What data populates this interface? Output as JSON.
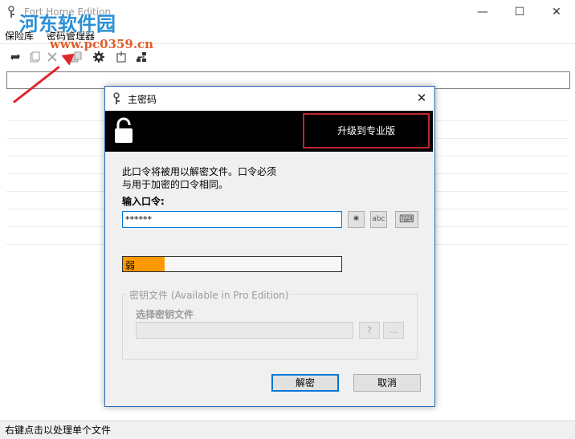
{
  "main_window": {
    "title": "Fort Home Edition",
    "controls": {
      "minimize": "—",
      "maximize": "☐",
      "close": "✕"
    },
    "menu": [
      "保险库",
      "密码管理器"
    ],
    "status": "右键点击以处理单个文件"
  },
  "watermark": {
    "title": "河东软件园",
    "url": "www.pc0359.cn"
  },
  "dialog": {
    "title": "主密码",
    "close": "✕",
    "upgrade_label": "升级到专业版",
    "description_line1": "此口令将被用以解密文件。口令必须",
    "description_line2": "与用于加密的口令相同。",
    "password_label": "输入口令:",
    "password_value": "******",
    "icons": {
      "reveal": "✱",
      "abc": "abc",
      "keyboard": "⌨"
    },
    "strength": {
      "label": "弱",
      "fraction": 0.19,
      "color": "#ff9900"
    },
    "keyfile": {
      "group_title": "密钥文件 (Available in Pro Edition)",
      "label": "选择密钥文件",
      "key_icon": "?",
      "browse": "..."
    },
    "decrypt_button": "解密",
    "cancel_button": "取消"
  },
  "colors": {
    "accent": "#0078d7",
    "upgrade_border": "#c0272d",
    "annotation_arrow": "#e0252b"
  }
}
